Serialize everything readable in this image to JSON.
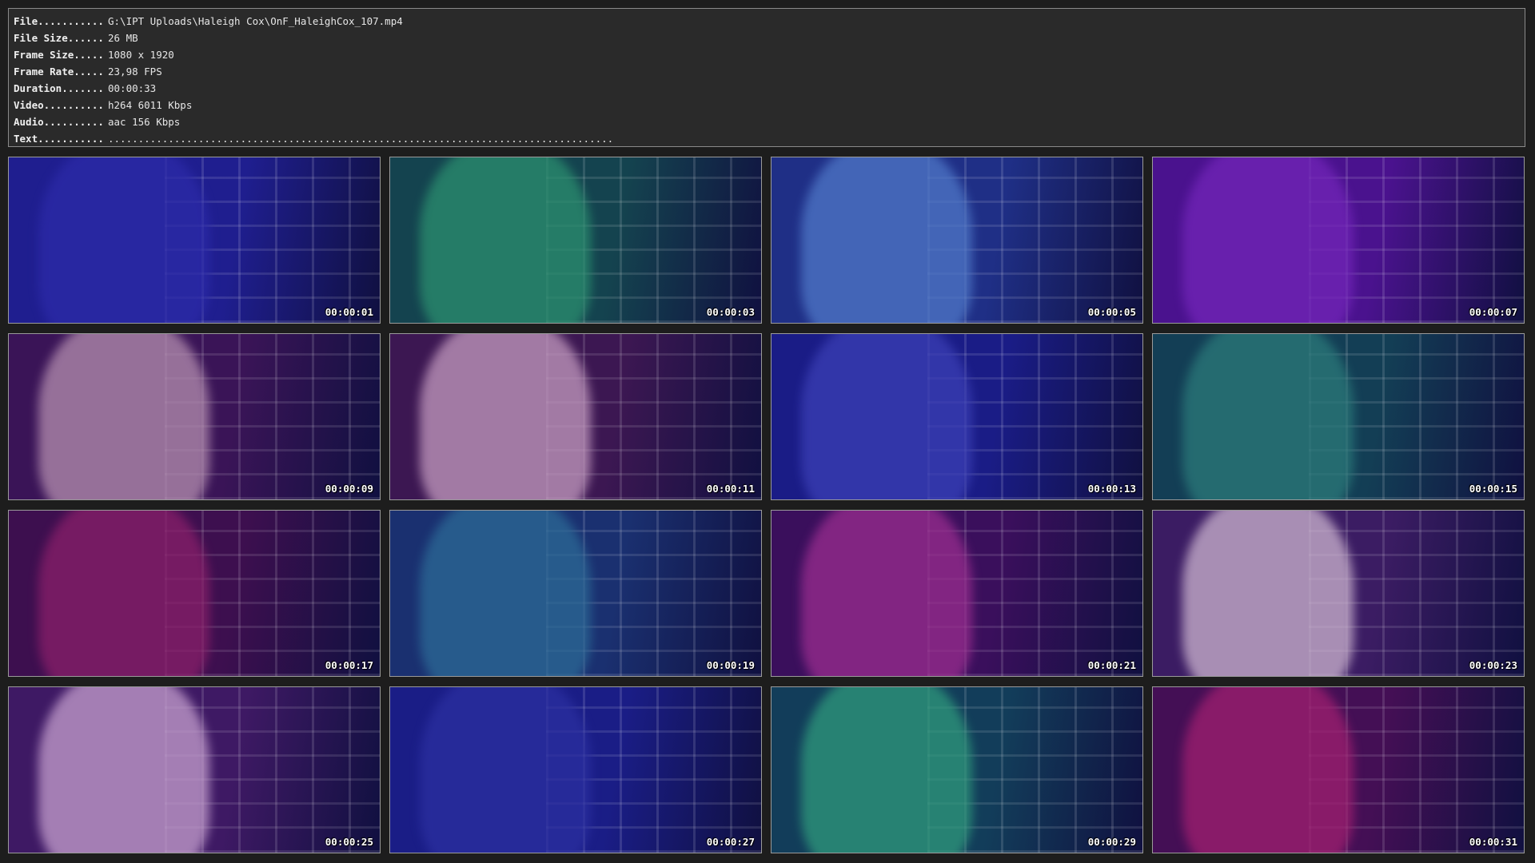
{
  "info": [
    {
      "key": "File...........",
      "value": "G:\\IPT Uploads\\Haleigh Cox\\OnF_HaleighCox_107.mp4"
    },
    {
      "key": "File Size......",
      "value": "26 MB"
    },
    {
      "key": "Frame Size.....",
      "value": "1080 x 1920"
    },
    {
      "key": "Frame Rate.....",
      "value": "23,98 FPS"
    },
    {
      "key": "Duration.......",
      "value": "00:00:33"
    },
    {
      "key": "Video..........",
      "value": "h264 6011 Kbps"
    },
    {
      "key": "Audio..........",
      "value": "aac 156 Kbps"
    },
    {
      "key": "Text...........",
      "value": "...................................................................................."
    }
  ],
  "thumbnails": [
    {
      "time": "00:00:01",
      "bg": "#1f1e8f",
      "accent": "#2c2aa8"
    },
    {
      "time": "00:00:03",
      "bg": "#14434f",
      "accent": "#2b8f6f"
    },
    {
      "time": "00:00:05",
      "bg": "#1f2f86",
      "accent": "#4f78c8"
    },
    {
      "time": "00:00:07",
      "bg": "#4a128e",
      "accent": "#7225b8"
    },
    {
      "time": "00:00:09",
      "bg": "#3a1457",
      "accent": "#b58fb0"
    },
    {
      "time": "00:00:11",
      "bg": "#3c1752",
      "accent": "#c49bc0"
    },
    {
      "time": "00:00:13",
      "bg": "#1a1c86",
      "accent": "#3b3fb5"
    },
    {
      "time": "00:00:15",
      "bg": "#133e55",
      "accent": "#2b7a7a"
    },
    {
      "time": "00:00:17",
      "bg": "#3d0f4f",
      "accent": "#8a1f6a"
    },
    {
      "time": "00:00:19",
      "bg": "#1a3070",
      "accent": "#2c6a96"
    },
    {
      "time": "00:00:21",
      "bg": "#3a0f5c",
      "accent": "#9a2d8f"
    },
    {
      "time": "00:00:23",
      "bg": "#3b1c63",
      "accent": "#cdb5d0"
    },
    {
      "time": "00:00:25",
      "bg": "#3e1964",
      "accent": "#c6a0cf"
    },
    {
      "time": "00:00:27",
      "bg": "#1a1d86",
      "accent": "#2b2fa0"
    },
    {
      "time": "00:00:29",
      "bg": "#123d5a",
      "accent": "#2f9a7c"
    },
    {
      "time": "00:00:31",
      "bg": "#440f55",
      "accent": "#a01f70"
    }
  ]
}
